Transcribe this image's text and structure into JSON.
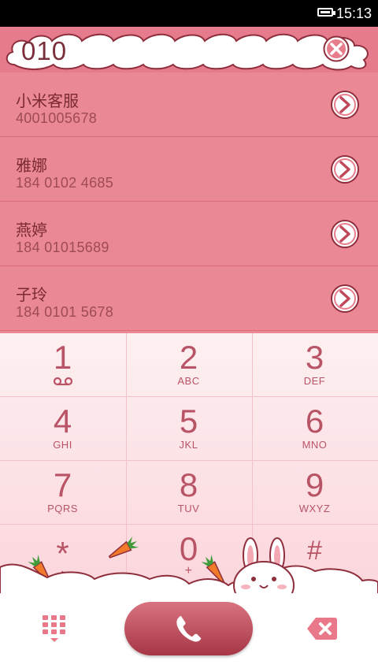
{
  "status_bar": {
    "time": "15:13"
  },
  "dialer": {
    "input_number": "010"
  },
  "contacts": [
    {
      "name": "小米客服",
      "phone": "4001005678"
    },
    {
      "name": "雅娜",
      "phone": "184 0102 4685"
    },
    {
      "name": "燕婷",
      "phone": "184 01015689"
    },
    {
      "name": "子玲",
      "phone": "184 0101 5678"
    }
  ],
  "keys": [
    {
      "digit": "1",
      "letters": ""
    },
    {
      "digit": "2",
      "letters": "ABC"
    },
    {
      "digit": "3",
      "letters": "DEF"
    },
    {
      "digit": "4",
      "letters": "GHI"
    },
    {
      "digit": "5",
      "letters": "JKL"
    },
    {
      "digit": "6",
      "letters": "MNO"
    },
    {
      "digit": "7",
      "letters": "PQRS"
    },
    {
      "digit": "8",
      "letters": "TUV"
    },
    {
      "digit": "9",
      "letters": "WXYZ"
    },
    {
      "digit": "*",
      "letters": ","
    },
    {
      "digit": "0",
      "letters": "+"
    },
    {
      "digit": "#",
      "letters": ""
    }
  ],
  "colors": {
    "accent": "#b95466",
    "header": "#e67b8d",
    "list": "#ea8896",
    "call": "#a73646"
  },
  "icons": [
    "battery-icon",
    "clear-icon",
    "arrow-right-icon",
    "voicemail-icon",
    "dialpad-icon",
    "phone-icon",
    "backspace-icon",
    "carrot-icon",
    "bunny-icon"
  ]
}
